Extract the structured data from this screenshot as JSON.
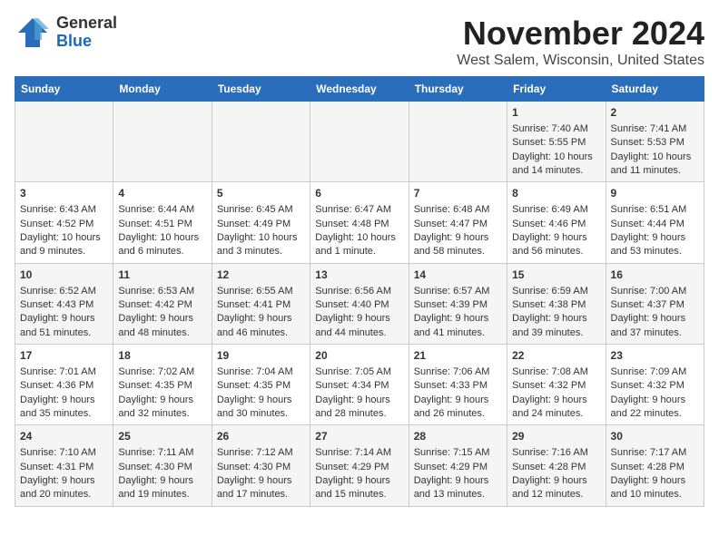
{
  "header": {
    "logo_line1": "General",
    "logo_line2": "Blue",
    "month": "November 2024",
    "location": "West Salem, Wisconsin, United States"
  },
  "days_of_week": [
    "Sunday",
    "Monday",
    "Tuesday",
    "Wednesday",
    "Thursday",
    "Friday",
    "Saturday"
  ],
  "weeks": [
    [
      {
        "day": "",
        "info": ""
      },
      {
        "day": "",
        "info": ""
      },
      {
        "day": "",
        "info": ""
      },
      {
        "day": "",
        "info": ""
      },
      {
        "day": "",
        "info": ""
      },
      {
        "day": "1",
        "info": "Sunrise: 7:40 AM\nSunset: 5:55 PM\nDaylight: 10 hours and 14 minutes."
      },
      {
        "day": "2",
        "info": "Sunrise: 7:41 AM\nSunset: 5:53 PM\nDaylight: 10 hours and 11 minutes."
      }
    ],
    [
      {
        "day": "3",
        "info": "Sunrise: 6:43 AM\nSunset: 4:52 PM\nDaylight: 10 hours and 9 minutes."
      },
      {
        "day": "4",
        "info": "Sunrise: 6:44 AM\nSunset: 4:51 PM\nDaylight: 10 hours and 6 minutes."
      },
      {
        "day": "5",
        "info": "Sunrise: 6:45 AM\nSunset: 4:49 PM\nDaylight: 10 hours and 3 minutes."
      },
      {
        "day": "6",
        "info": "Sunrise: 6:47 AM\nSunset: 4:48 PM\nDaylight: 10 hours and 1 minute."
      },
      {
        "day": "7",
        "info": "Sunrise: 6:48 AM\nSunset: 4:47 PM\nDaylight: 9 hours and 58 minutes."
      },
      {
        "day": "8",
        "info": "Sunrise: 6:49 AM\nSunset: 4:46 PM\nDaylight: 9 hours and 56 minutes."
      },
      {
        "day": "9",
        "info": "Sunrise: 6:51 AM\nSunset: 4:44 PM\nDaylight: 9 hours and 53 minutes."
      }
    ],
    [
      {
        "day": "10",
        "info": "Sunrise: 6:52 AM\nSunset: 4:43 PM\nDaylight: 9 hours and 51 minutes."
      },
      {
        "day": "11",
        "info": "Sunrise: 6:53 AM\nSunset: 4:42 PM\nDaylight: 9 hours and 48 minutes."
      },
      {
        "day": "12",
        "info": "Sunrise: 6:55 AM\nSunset: 4:41 PM\nDaylight: 9 hours and 46 minutes."
      },
      {
        "day": "13",
        "info": "Sunrise: 6:56 AM\nSunset: 4:40 PM\nDaylight: 9 hours and 44 minutes."
      },
      {
        "day": "14",
        "info": "Sunrise: 6:57 AM\nSunset: 4:39 PM\nDaylight: 9 hours and 41 minutes."
      },
      {
        "day": "15",
        "info": "Sunrise: 6:59 AM\nSunset: 4:38 PM\nDaylight: 9 hours and 39 minutes."
      },
      {
        "day": "16",
        "info": "Sunrise: 7:00 AM\nSunset: 4:37 PM\nDaylight: 9 hours and 37 minutes."
      }
    ],
    [
      {
        "day": "17",
        "info": "Sunrise: 7:01 AM\nSunset: 4:36 PM\nDaylight: 9 hours and 35 minutes."
      },
      {
        "day": "18",
        "info": "Sunrise: 7:02 AM\nSunset: 4:35 PM\nDaylight: 9 hours and 32 minutes."
      },
      {
        "day": "19",
        "info": "Sunrise: 7:04 AM\nSunset: 4:35 PM\nDaylight: 9 hours and 30 minutes."
      },
      {
        "day": "20",
        "info": "Sunrise: 7:05 AM\nSunset: 4:34 PM\nDaylight: 9 hours and 28 minutes."
      },
      {
        "day": "21",
        "info": "Sunrise: 7:06 AM\nSunset: 4:33 PM\nDaylight: 9 hours and 26 minutes."
      },
      {
        "day": "22",
        "info": "Sunrise: 7:08 AM\nSunset: 4:32 PM\nDaylight: 9 hours and 24 minutes."
      },
      {
        "day": "23",
        "info": "Sunrise: 7:09 AM\nSunset: 4:32 PM\nDaylight: 9 hours and 22 minutes."
      }
    ],
    [
      {
        "day": "24",
        "info": "Sunrise: 7:10 AM\nSunset: 4:31 PM\nDaylight: 9 hours and 20 minutes."
      },
      {
        "day": "25",
        "info": "Sunrise: 7:11 AM\nSunset: 4:30 PM\nDaylight: 9 hours and 19 minutes."
      },
      {
        "day": "26",
        "info": "Sunrise: 7:12 AM\nSunset: 4:30 PM\nDaylight: 9 hours and 17 minutes."
      },
      {
        "day": "27",
        "info": "Sunrise: 7:14 AM\nSunset: 4:29 PM\nDaylight: 9 hours and 15 minutes."
      },
      {
        "day": "28",
        "info": "Sunrise: 7:15 AM\nSunset: 4:29 PM\nDaylight: 9 hours and 13 minutes."
      },
      {
        "day": "29",
        "info": "Sunrise: 7:16 AM\nSunset: 4:28 PM\nDaylight: 9 hours and 12 minutes."
      },
      {
        "day": "30",
        "info": "Sunrise: 7:17 AM\nSunset: 4:28 PM\nDaylight: 9 hours and 10 minutes."
      }
    ]
  ]
}
